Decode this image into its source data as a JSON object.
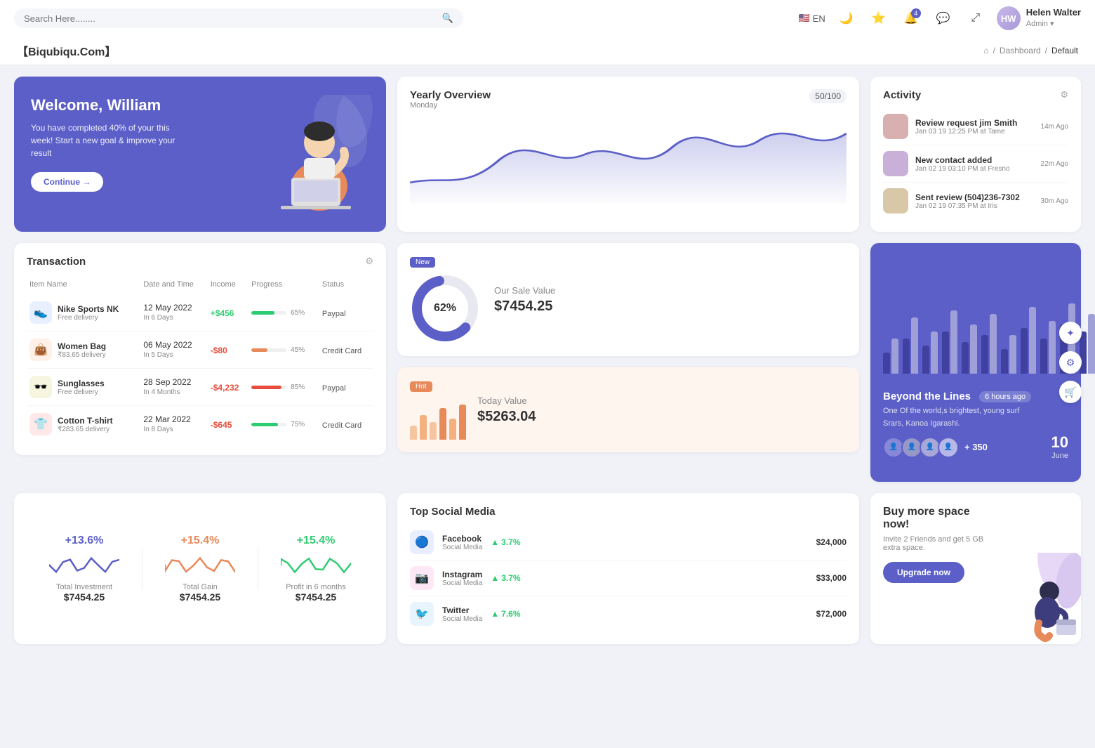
{
  "topnav": {
    "search_placeholder": "Search Here........",
    "lang": "EN",
    "notification_count": "4",
    "user": {
      "name": "Helen Walter",
      "role": "Admin",
      "initials": "HW"
    }
  },
  "breadcrumb": {
    "brand": "【Biqubiqu.Com】",
    "home_label": "⌂",
    "separator": "/",
    "dashboard": "Dashboard",
    "current": "Default"
  },
  "welcome": {
    "title": "Welcome, William",
    "subtitle": "You have completed 40% of your this week! Start a new goal & improve your result",
    "button": "Continue →"
  },
  "yearly_overview": {
    "title": "Yearly Overview",
    "subtitle": "Monday",
    "progress": "50/100"
  },
  "activity": {
    "title": "Activity",
    "items": [
      {
        "title": "Review request jim Smith",
        "subtitle": "Jan 03 19 12:25 PM at Tame",
        "time": "14m Ago"
      },
      {
        "title": "New contact added",
        "subtitle": "Jan 02 19 03:10 PM at Fresno",
        "time": "22m Ago"
      },
      {
        "title": "Sent review (504)236-7302",
        "subtitle": "Jan 02 19 07:35 PM at Iris",
        "time": "30m Ago"
      }
    ]
  },
  "transaction": {
    "title": "Transaction",
    "columns": [
      "Item Name",
      "Date and Time",
      "Income",
      "Progress",
      "Status"
    ],
    "rows": [
      {
        "icon": "👟",
        "icon_bg": "#e8f0ff",
        "name": "Nike Sports NK",
        "sub": "Free delivery",
        "date": "12 May 2022",
        "days": "In 6 Days",
        "income": "+$456",
        "income_type": "pos",
        "progress": 65,
        "progress_color": "#2ecc71",
        "status": "Paypal"
      },
      {
        "icon": "👜",
        "icon_bg": "#fff0e8",
        "name": "Women Bag",
        "sub": "₹83.65 delivery",
        "date": "06 May 2022",
        "days": "In 5 Days",
        "income": "-$80",
        "income_type": "neg",
        "progress": 45,
        "progress_color": "#e8895a",
        "status": "Credit Card"
      },
      {
        "icon": "🕶️",
        "icon_bg": "#f5f5e0",
        "name": "Sunglasses",
        "sub": "Free delivery",
        "date": "28 Sep 2022",
        "days": "In 4 Months",
        "income": "-$4,232",
        "income_type": "neg",
        "progress": 85,
        "progress_color": "#e74c3c",
        "status": "Paypal"
      },
      {
        "icon": "👕",
        "icon_bg": "#ffe8e8",
        "name": "Cotton T-shirt",
        "sub": "₹283.65 delivery",
        "date": "22 Mar 2022",
        "days": "In 8 Days",
        "income": "-$645",
        "income_type": "neg",
        "progress": 75,
        "progress_color": "#2ecc71",
        "status": "Credit Card"
      }
    ]
  },
  "sale_value": {
    "badge": "New",
    "percent": "62%",
    "title": "Our Sale Value",
    "value": "$7454.25"
  },
  "today_value": {
    "badge": "Hot",
    "title": "Today Value",
    "value": "$5263.04"
  },
  "bar_chart": {
    "title": "Beyond the Lines",
    "time_ago": "6 hours ago",
    "desc1": "One Of the world,s brightest, young surf",
    "desc2": "Srars, Kanoa Igarashi.",
    "plus_count": "+ 350",
    "date_num": "10",
    "date_month": "June"
  },
  "stats": [
    {
      "pct": "+13.6%",
      "label": "Total Investment",
      "value": "$7454.25",
      "color": "#5b5fc7"
    },
    {
      "pct": "+15.4%",
      "label": "Total Gain",
      "value": "$7454.25",
      "color": "#e8895a"
    },
    {
      "pct": "+15.4%",
      "label": "Profit in 6 months",
      "value": "$7454.25",
      "color": "#2ecc71"
    }
  ],
  "social_media": {
    "title": "Top Social Media",
    "items": [
      {
        "name": "Facebook",
        "type": "Social Media",
        "growth": "3.7%",
        "amount": "$24,000",
        "color": "#3b5998",
        "bg": "#e8eeff"
      },
      {
        "name": "Instagram",
        "type": "Social Media",
        "growth": "3.7%",
        "amount": "$33,000",
        "color": "#c13584",
        "bg": "#ffe8f5"
      },
      {
        "name": "Twitter",
        "type": "Social Media",
        "growth": "7.6%",
        "amount": "$72,000",
        "color": "#1da1f2",
        "bg": "#e8f5ff"
      }
    ]
  },
  "upgrade": {
    "title": "Buy more space now!",
    "desc": "Invite 2 Friends and get 5 GB extra space.",
    "button": "Upgrade now"
  }
}
